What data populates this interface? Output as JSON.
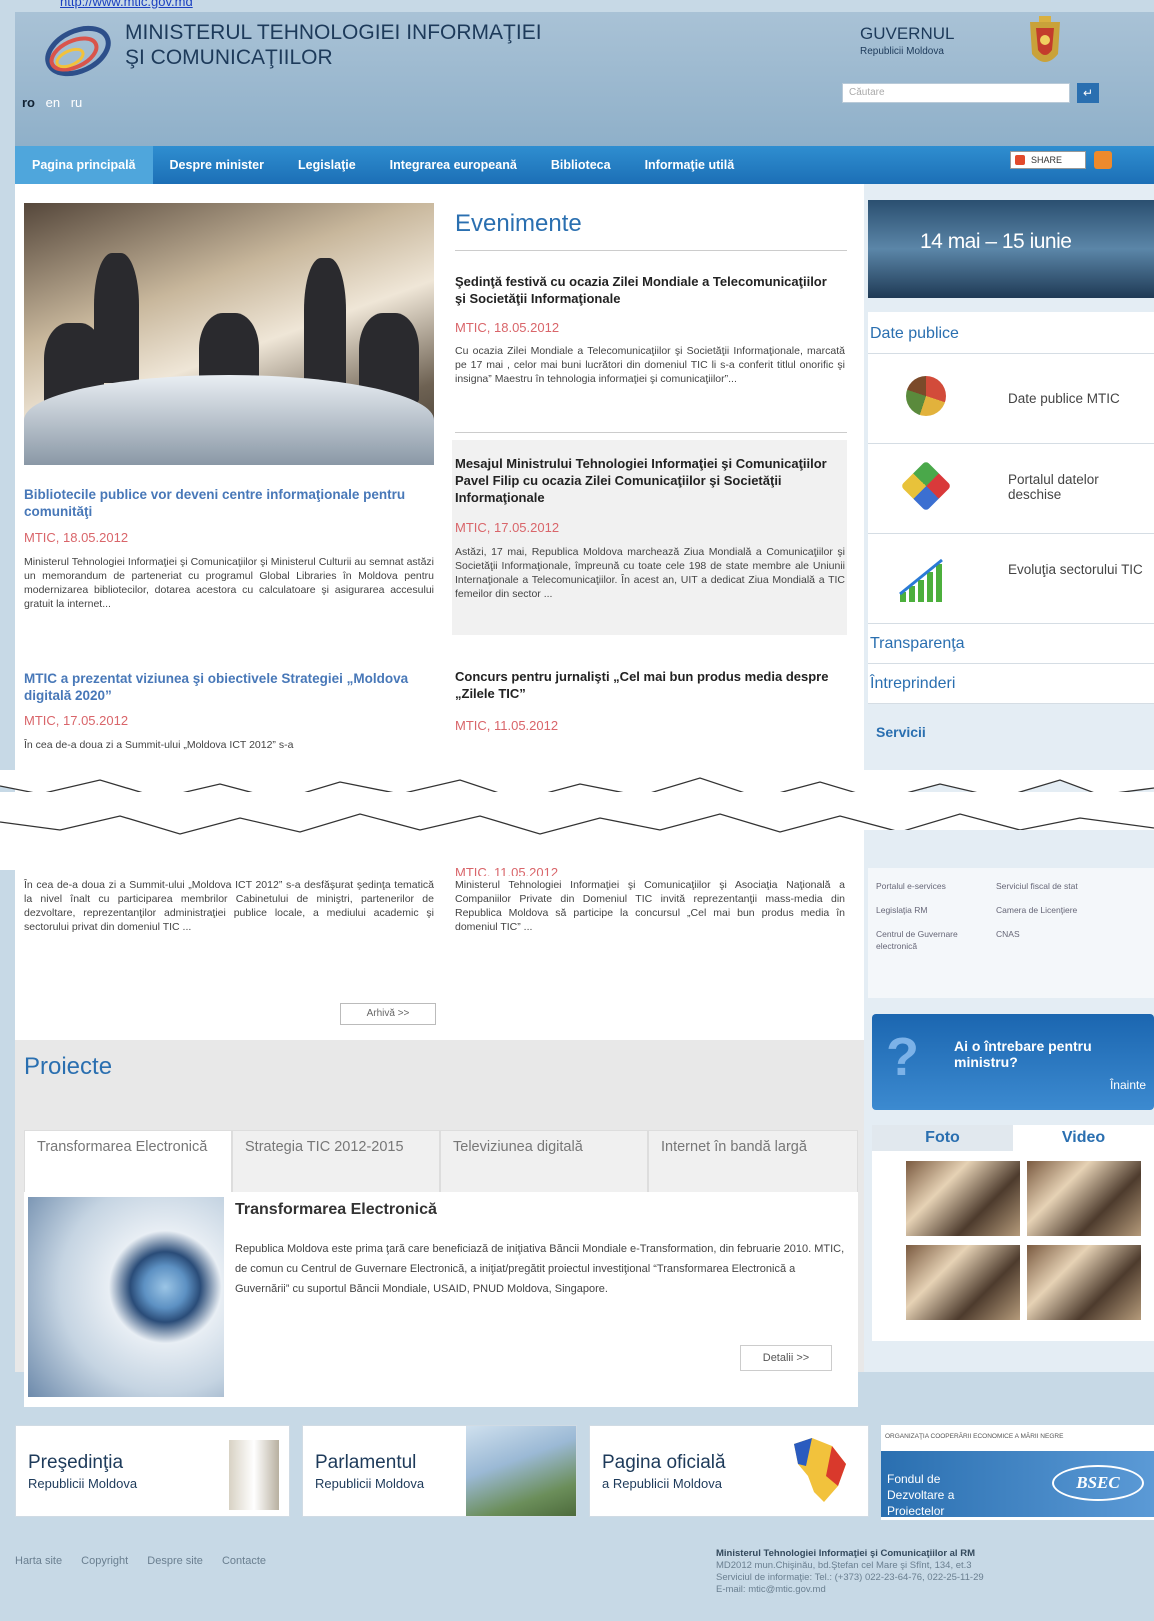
{
  "header": {
    "url": "http://www.mtic.gov.md",
    "ministry_line1": "MINISTERUL TEHNOLOGIEI INFORMAŢIEI",
    "ministry_line2": "ŞI COMUNICAŢIILOR",
    "languages": [
      "ro",
      "en",
      "ru"
    ],
    "gov_title": "GUVERNUL",
    "gov_subtitle": "Republicii Moldova",
    "search_placeholder": "Căutare"
  },
  "nav": {
    "items": [
      "Pagina principală",
      "Despre minister",
      "Legislaţie",
      "Integrarea europeană",
      "Biblioteca",
      "Informaţie utilă"
    ],
    "share": "SHARE"
  },
  "left_news": [
    {
      "title": "Bibliotecile publice vor deveni centre informaţionale pentru comunităţi",
      "date": "MTIC, 18.05.2012",
      "text": "Ministerul Tehnologiei Informaţiei şi Comunicaţiilor şi Ministerul Culturii au semnat astăzi un memorandum de parteneriat cu programul Global Libraries în Moldova pentru modernizarea bibliotecilor, dotarea acestora cu calculatoare şi asigurarea accesului gratuit la internet..."
    },
    {
      "title": "MTIC a prezentat viziunea şi obiectivele Strategiei „Moldova digitală 2020”",
      "date": "MTIC, 17.05.2012",
      "text_cut": "În cea de-a doua zi a Summit-ului „Moldova ICT 2012” s-a",
      "text": "În cea de-a doua zi a Summit-ului „Moldova ICT 2012” s-a desfăşurat şedinţa tematică la nivel înalt cu participarea membrilor Cabinetului de miniştri, partenerilor de dezvoltare, reprezentanţilor administraţiei publice locale, a mediului academic şi sectorului privat din domeniul TIC ..."
    }
  ],
  "events": {
    "heading": "Evenimente",
    "items": [
      {
        "title": "Şedinţă festivă cu ocazia Zilei Mondiale a Telecomunicaţiilor şi Societăţii Informaţionale",
        "date": "MTIC, 18.05.2012",
        "text": "Cu ocazia Zilei Mondiale a Telecomunicaţiilor şi Societăţii Informaţionale, marcată pe 17 mai , celor mai buni lucrători din domeniul TIC li s-a conferit titlul onorific şi insigna” Maestru în tehnologia informaţiei şi comunicaţiilor”..."
      },
      {
        "title": "Mesajul Ministrului Tehnologiei Informaţiei şi Comunicaţiilor Pavel Filip cu ocazia Zilei Comunicaţiilor şi Societăţii Informaţionale",
        "date": "MTIC, 17.05.2012",
        "text": "Astăzi, 17 mai, Republica Moldova marchează Ziua Mondială a Comunicaţiilor şi Societăţii Informaţionale, împreună cu toate cele 198 de state membre ale Uniunii Internaţionale a Telecomunicaţiilor. În acest an, UIT a dedicat Ziua Mondială a TIC femeilor din sector ..."
      },
      {
        "title": "Concurs pentru jurnalişti „Cel mai bun produs media despre „Zilele TIC”",
        "date": "MTIC, 11.05.2012",
        "date_cut": "MTIC, 11.05.2012",
        "text": "Ministerul Tehnologiei Informaţiei şi Comunicaţiilor şi Asociaţia Naţională a Companiilor Private din Domeniul TIC invită reprezentanţii mass-media din Republica Moldova să participe la concursul „Cel mai bun produs media în domeniul TIC” ..."
      }
    ],
    "archive": "Arhivă >>"
  },
  "sidebar": {
    "banner": "14 mai – 15 iunie",
    "date_publice": "Date publice",
    "items": [
      "Date publice MTIC",
      "Portalul datelor deschise",
      "Evoluţia sectorului TIC"
    ],
    "transparenta": "Transparenţa",
    "intreprinderi": "Întreprinderi",
    "servicii": "Servicii",
    "services": [
      "Portalul e-services",
      "Serviciul fiscal de stat",
      "Legislaţia RM",
      "Camera de Licenţiere",
      "Centrul de Guvernare electronică",
      "CNAS"
    ],
    "question": "Ai o întrebare pentru ministru?",
    "question_link": "Înainte",
    "foto": "Foto",
    "video": "Video",
    "bsec_top": "ORGANIZAŢIA COOPERĂRII ECONOMICE A MĂRII NEGRE",
    "bsec_text": "Fondul de Dezvoltare a Proiectelor",
    "bsec_logo": "BSEC"
  },
  "projects": {
    "heading": "Proiecte",
    "tabs": [
      "Transformarea Electronică",
      "Strategia TIC 2012-2015",
      "Televiziunea digitală",
      "Internet în bandă largă"
    ],
    "title": "Transformarea Electronică",
    "text": "Republica Moldova este prima ţară care beneficiază de iniţiativa Băncii Mondiale e-Transformation, din februarie 2010. MTIC, de comun cu Centrul de Guvernare Electronică, a iniţiat/pregătit proiectul investiţional “Transformarea Electronică a Guvernării” cu suportul Băncii Mondiale, USAID, PNUD Moldova, Singapore.",
    "details": "Detalii >>"
  },
  "footer_banners": [
    {
      "a": "Preşedinţia",
      "b": "Republicii Moldova"
    },
    {
      "a": "Parlamentul",
      "b": "Republicii Moldova"
    },
    {
      "a": "Pagina oficială",
      "b": "a Republicii Moldova"
    }
  ],
  "footer": {
    "links": [
      "Harta site",
      "Copyright",
      "Despre site",
      "Contacte"
    ],
    "org": "Ministerul Tehnologiei Informaţiei şi Comunicaţiilor al RM",
    "addr1": "MD2012 mun.Chişinău, bd.Ştefan cel Mare şi Sfînt, 134, et.3",
    "addr2": "Serviciul de informaţie: Tel.: (+373) 022-23-64-76, 022-25-11-29",
    "addr3": "E-mail: mtic@mtic.gov.md"
  }
}
